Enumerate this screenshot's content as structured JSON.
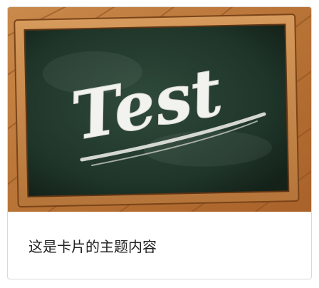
{
  "card": {
    "image": {
      "chalk_word": "Test"
    },
    "body_text": "这是卡片的主题内容"
  }
}
